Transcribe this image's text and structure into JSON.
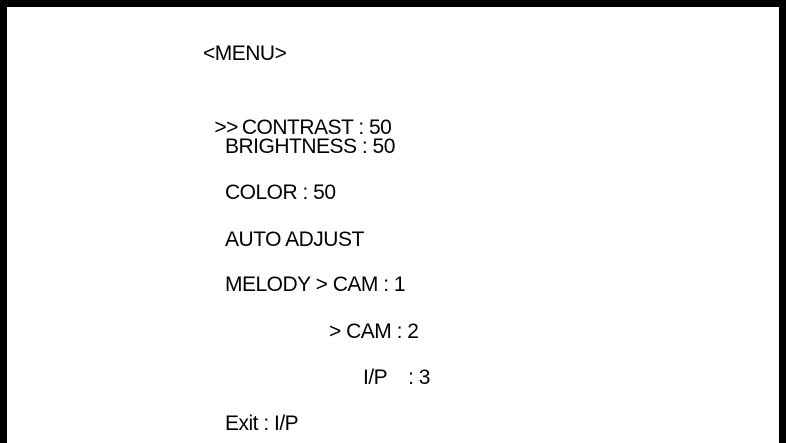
{
  "menu": {
    "title": "<MENU>",
    "cursor": ">>",
    "items": [
      {
        "label": "CONTRAST : 50"
      },
      {
        "label": "BRIGHTNESS : 50"
      },
      {
        "label": "COLOR : 50"
      },
      {
        "label": "AUTO ADJUST"
      },
      {
        "label": "MELODY > CAM : 1"
      },
      {
        "label": "> CAM : 2"
      },
      {
        "label": "I/P    : 3"
      },
      {
        "label": "Exit : I/P"
      }
    ]
  }
}
